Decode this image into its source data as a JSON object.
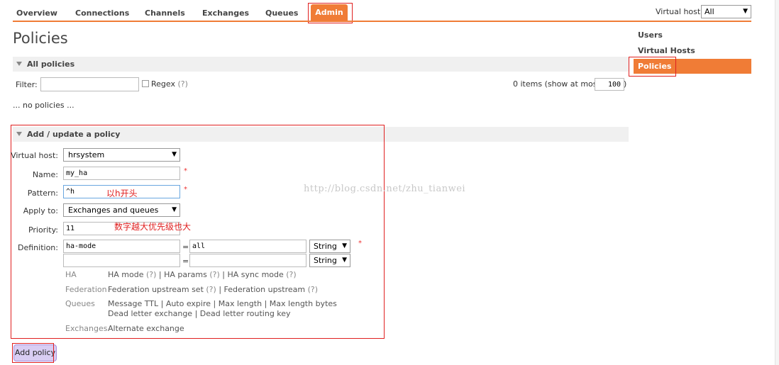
{
  "nav": {
    "items": [
      "Overview",
      "Connections",
      "Channels",
      "Exchanges",
      "Queues"
    ],
    "active": "Admin"
  },
  "vhost_top": {
    "label": "Virtual host:",
    "value": "All"
  },
  "page_title": "Policies",
  "sidebar": {
    "items": [
      "Users",
      "Virtual Hosts"
    ],
    "active": "Policies"
  },
  "all_policies": {
    "header": "All policies",
    "filter_label": "Filter:",
    "filter_value": "",
    "regex_label": "Regex",
    "regex_help": "(?)",
    "count_text": "0 items (show at most",
    "show_max": "100",
    "count_close": ")",
    "empty_text": "... no policies ..."
  },
  "form": {
    "header": "Add / update a policy",
    "vhost_label": "Virtual host:",
    "vhost_value": "hrsystem",
    "name_label": "Name:",
    "name_value": "my_ha",
    "pattern_label": "Pattern:",
    "pattern_value": "^h",
    "pattern_note": "以h开头",
    "apply_label": "Apply to:",
    "apply_value": "Exchanges and queues",
    "priority_label": "Priority:",
    "priority_value": "11",
    "priority_note": "数字越大优先级也大",
    "definition_label": "Definition:",
    "def_rows": [
      {
        "key": "ha-mode",
        "eq": "=",
        "value": "all",
        "type": "String"
      },
      {
        "key": "",
        "eq": "=",
        "value": "",
        "type": "String"
      }
    ],
    "required": "*",
    "help": {
      "ha_cat": "HA",
      "ha_mode": "HA mode",
      "ha_params": "HA params",
      "ha_sync": "HA sync mode",
      "fed_cat": "Federation",
      "fed_set": "Federation upstream set",
      "fed_up": "Federation upstream",
      "queues_cat": "Queues",
      "q_ttl": "Message TTL",
      "q_expire": "Auto expire",
      "q_maxlen": "Max length",
      "q_maxbytes": "Max length bytes",
      "q_dlx": "Dead letter exchange",
      "q_dlrk": "Dead letter routing key",
      "ex_cat": "Exchanges",
      "ex_alt": "Alternate exchange",
      "qmark": "(?)",
      "sep": "|"
    },
    "submit": "Add policy"
  },
  "watermark": "http://blog.csdn.net/zhu_tianwei",
  "colors": {
    "accent": "#f07c36",
    "annotation": "#e02020",
    "button": "#d9cdf3"
  }
}
